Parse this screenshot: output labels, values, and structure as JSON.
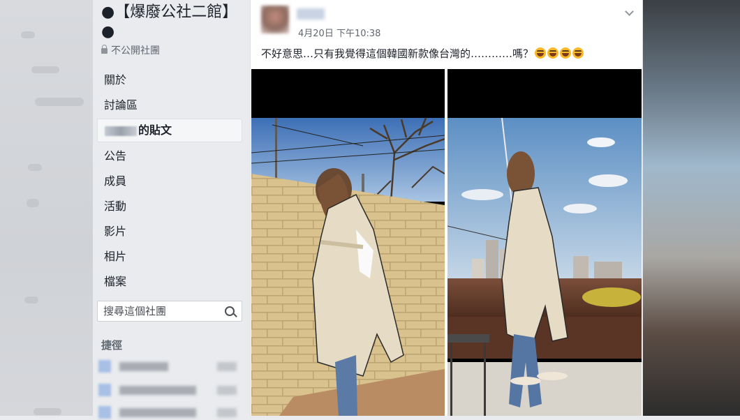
{
  "group": {
    "title": "●【爆廢公社二館】●",
    "privacy": "不公開社團"
  },
  "nav": [
    {
      "label": "關於"
    },
    {
      "label": "討論區"
    },
    {
      "label": "的貼文",
      "active": true
    },
    {
      "label": "公告"
    },
    {
      "label": "成員"
    },
    {
      "label": "活動"
    },
    {
      "label": "影片"
    },
    {
      "label": "相片"
    },
    {
      "label": "檔案"
    }
  ],
  "search": {
    "placeholder": "搜尋這個社團",
    "icon": "search-icon"
  },
  "shortcuts": {
    "title": "捷徑"
  },
  "post": {
    "timestamp": "4月20日 下午10:38",
    "message": "不好意思…只有我覺得這個韓國新款像台灣的…………嗎？",
    "emoji_count": 4,
    "photos": [
      "photo-1",
      "photo-2"
    ]
  },
  "colors": {
    "sidebar_bg": "#e9ebee",
    "text": "#1d2129",
    "muted": "#616770"
  }
}
